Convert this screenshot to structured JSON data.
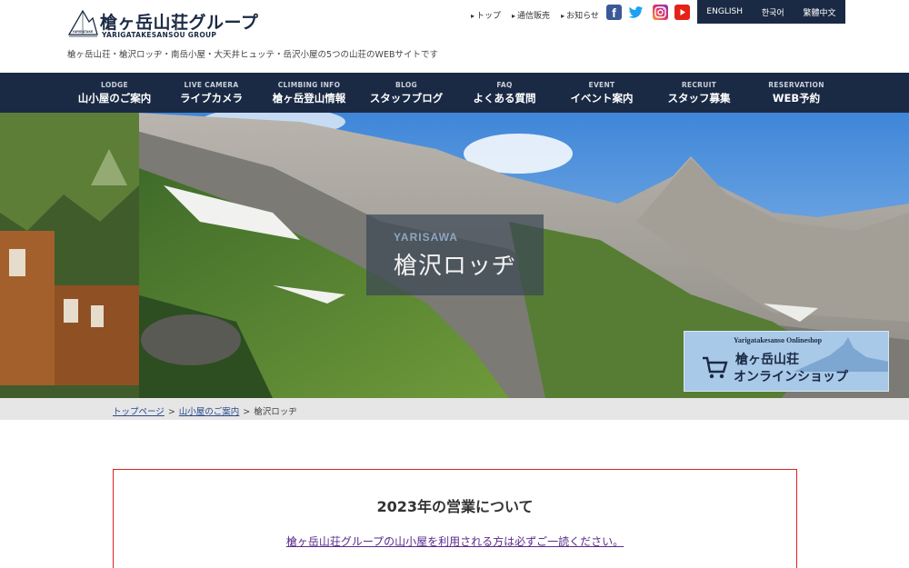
{
  "header": {
    "logo_text": "槍ヶ岳山荘グループ",
    "logo_sub": "YARIGATAKESANSOU GROUP",
    "logo_mark_text": "YARIGATAKE",
    "tagline": "槍ヶ岳山荘・槍沢ロッヂ・南岳小屋・大天井ヒュッテ・岳沢小屋の5つの山荘のWEBサイトです",
    "top_links": [
      "トップ",
      "通信販売",
      "お知らせ"
    ],
    "social": {
      "facebook": "facebook-icon",
      "twitter": "twitter-icon",
      "instagram": "instagram-icon",
      "youtube": "youtube-icon"
    },
    "languages": [
      "ENGLISH",
      "한국어",
      "繁體中文"
    ]
  },
  "nav": [
    {
      "en": "LODGE",
      "jp": "山小屋のご案内"
    },
    {
      "en": "LIVE CAMERA",
      "jp": "ライブカメラ"
    },
    {
      "en": "CLIMBING INFO",
      "jp": "槍ヶ岳登山情報"
    },
    {
      "en": "BLOG",
      "jp": "スタッフブログ"
    },
    {
      "en": "FAQ",
      "jp": "よくある質問"
    },
    {
      "en": "EVENT",
      "jp": "イベント案内"
    },
    {
      "en": "RECRUIT",
      "jp": "スタッフ募集"
    },
    {
      "en": "RESERVATION",
      "jp": "WEB予約"
    }
  ],
  "hero": {
    "title_en": "YARISAWA",
    "title_jp": "槍沢ロッヂ"
  },
  "shop_banner": {
    "en": "Yarigatakesanso Onlineshop",
    "line1": "槍ヶ岳山荘",
    "line2": "オンラインショップ"
  },
  "breadcrumb": {
    "items": [
      "トップページ",
      "山小屋のご案内",
      "槍沢ロッヂ"
    ],
    "separator": ">"
  },
  "notice": {
    "title": "2023年の営業について",
    "link": "槍ヶ岳山荘グループの山小屋を利用される方は必ずご一読ください。"
  },
  "colors": {
    "navy": "#1b2a44",
    "notice_border": "#dd2222",
    "link": "#5a2a8a"
  }
}
